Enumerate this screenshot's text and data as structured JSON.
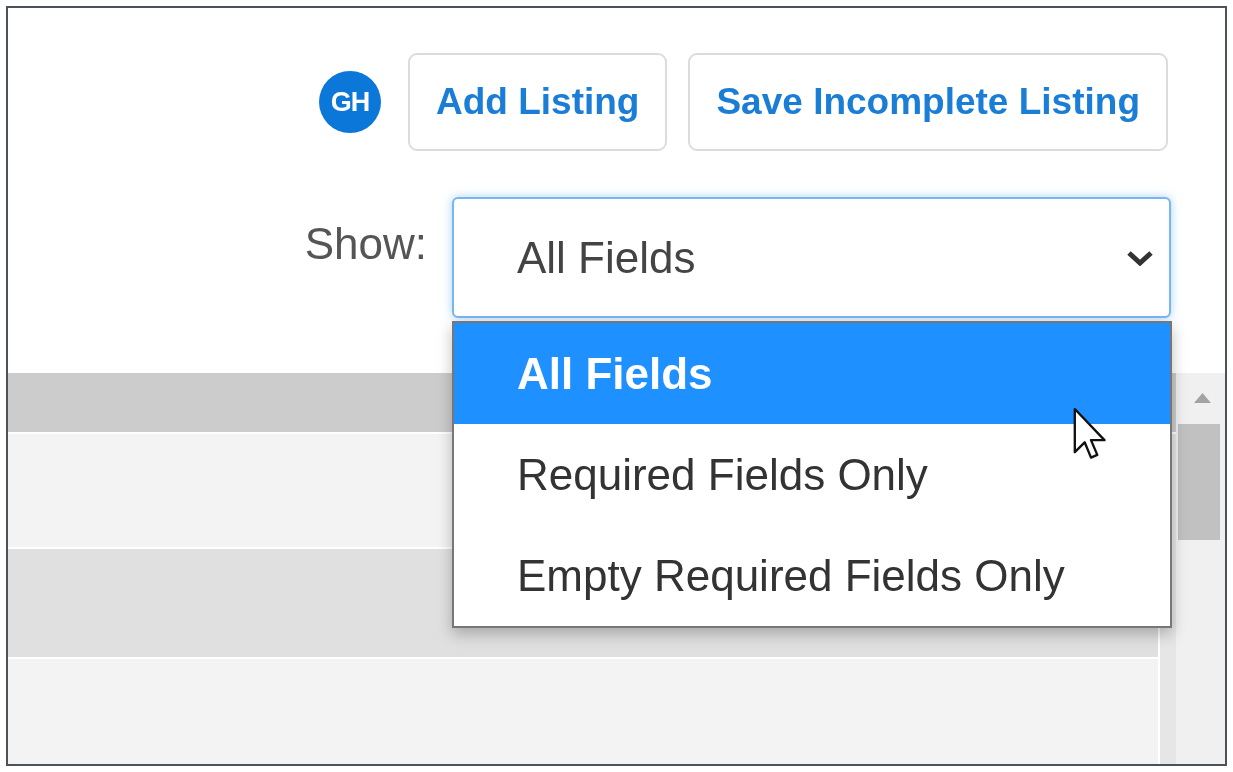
{
  "toolbar": {
    "avatar": {
      "initials": "GH"
    },
    "buttons": [
      {
        "label": "Add Listing"
      },
      {
        "label": "Save Incomplete Listing"
      }
    ]
  },
  "filter": {
    "label": "Show:",
    "select": {
      "value": "All Fields",
      "expanded": true,
      "options": [
        {
          "label": "All Fields",
          "selected": true
        },
        {
          "label": "Required Fields Only",
          "selected": false
        },
        {
          "label": "Empty Required Fields Only",
          "selected": false
        }
      ]
    }
  }
}
